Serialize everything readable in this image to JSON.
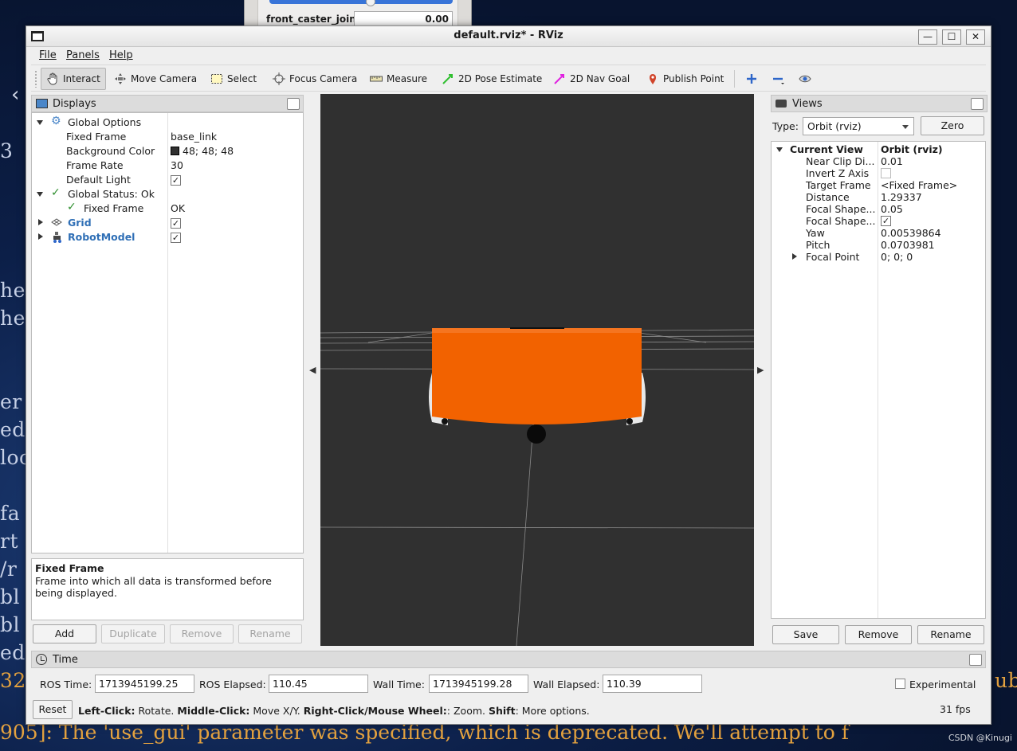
{
  "window": {
    "title": "default.rviz* - RViz",
    "min_glyph": "—",
    "max_glyph": "☐",
    "close_glyph": "✕"
  },
  "background_terminal": {
    "lines": [
      "3",
      "her",
      "her",
      "er",
      "ed",
      "loc",
      "fa",
      "rt",
      "/r",
      "bl",
      "bl",
      "ed",
      "32"
    ],
    "bottom_line": "905]: The 'use_gui' parameter was specified, which is deprecated.  We'll attempt to f",
    "right_fragment": "ub",
    "watermark": "CSDN @Kinugi"
  },
  "joint_state_publisher": {
    "joint_label": "front_caster_joint",
    "joint_value": "0.00",
    "slider_fraction": 0.55
  },
  "menu": {
    "file": "File",
    "panels": "Panels",
    "help": "Help"
  },
  "toolbar": {
    "interact": "Interact",
    "move_camera": "Move Camera",
    "select": "Select",
    "focus_camera": "Focus Camera",
    "measure": "Measure",
    "pose_estimate": "2D Pose Estimate",
    "nav_goal": "2D Nav Goal",
    "publish_point": "Publish Point"
  },
  "displays": {
    "title": "Displays",
    "global_options": "Global Options",
    "fixed_frame_label": "Fixed Frame",
    "fixed_frame_value": "base_link",
    "bg_color_label": "Background Color",
    "bg_color_value": "48; 48; 48",
    "bg_color_hex": "#303030",
    "frame_rate_label": "Frame Rate",
    "frame_rate_value": "30",
    "default_light_label": "Default Light",
    "global_status": "Global Status: Ok",
    "status_fixed_frame": "Fixed Frame",
    "status_fixed_frame_value": "OK",
    "grid": "Grid",
    "robot_model": "RobotModel",
    "check_glyph": "✓",
    "desc_title": "Fixed Frame",
    "desc_body": "Frame into which all data is transformed before being displayed.",
    "add": "Add",
    "duplicate": "Duplicate",
    "remove": "Remove",
    "rename": "Rename"
  },
  "views": {
    "title": "Views",
    "type_label": "Type:",
    "type_value": "Orbit (rviz)",
    "zero": "Zero",
    "current_view": "Current View",
    "current_view_value": "Orbit (rviz)",
    "props": [
      {
        "k": "Near Clip Di...",
        "v": "0.01"
      },
      {
        "k": "Invert Z Axis",
        "v": ""
      },
      {
        "k": "Target Frame",
        "v": "<Fixed Frame>"
      },
      {
        "k": "Distance",
        "v": "1.29337"
      },
      {
        "k": "Focal Shape...",
        "v": "0.05"
      },
      {
        "k": "Focal Shape...",
        "v": "✓"
      },
      {
        "k": "Yaw",
        "v": "0.00539864"
      },
      {
        "k": "Pitch",
        "v": "0.0703981"
      },
      {
        "k": "Focal Point",
        "v": "0; 0; 0"
      }
    ],
    "save": "Save",
    "remove": "Remove",
    "rename": "Rename"
  },
  "time": {
    "title": "Time",
    "ros_time_label": "ROS Time:",
    "ros_time": "1713945199.25",
    "ros_elapsed_label": "ROS Elapsed:",
    "ros_elapsed": "110.45",
    "wall_time_label": "Wall Time:",
    "wall_time": "1713945199.28",
    "wall_elapsed_label": "Wall Elapsed:",
    "wall_elapsed": "110.39",
    "experimental": "Experimental",
    "reset": "Reset",
    "hint_leftclick": "Left-Click:",
    "hint_rotate": " Rotate. ",
    "hint_middleclick": "Middle-Click:",
    "hint_move": " Move X/Y. ",
    "hint_rightclick": "Right-Click/Mouse Wheel:",
    "hint_zoom": ": Zoom. ",
    "hint_shift": "Shift",
    "hint_more": ": More options.",
    "fps": "31 fps"
  },
  "colors": {
    "robot_body": "#f26200",
    "viewport_bg": "#303030",
    "accent_blue": "#2f6fb6"
  }
}
